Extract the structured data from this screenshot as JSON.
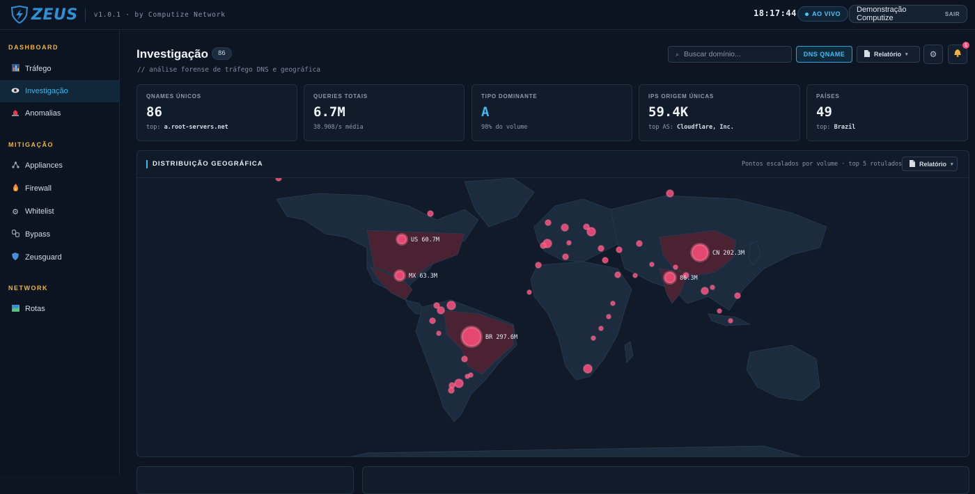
{
  "header": {
    "logo_text": "ZEUS",
    "version": "v1.0.1 · by Computize Network",
    "clock": "18:17:44",
    "live_label": "AO VIVO",
    "user_name": "Demonstração Computize",
    "logout_label": "SAIR"
  },
  "sidebar": {
    "sections": [
      {
        "title": "DASHBOARD",
        "items": [
          {
            "label": "Tráfego",
            "icon": "chart-icon"
          },
          {
            "label": "Investigação",
            "icon": "eye-icon",
            "active": true
          },
          {
            "label": "Anomalias",
            "icon": "siren-icon"
          }
        ]
      },
      {
        "title": "MITIGAÇÃO",
        "items": [
          {
            "label": "Appliances",
            "icon": "network-icon"
          },
          {
            "label": "Firewall",
            "icon": "fire-icon"
          },
          {
            "label": "Whitelist",
            "icon": "gear-icon"
          },
          {
            "label": "Bypass",
            "icon": "chain-icon"
          },
          {
            "label": "Zeusguard",
            "icon": "shield-icon"
          }
        ]
      },
      {
        "title": "NETWORK",
        "items": [
          {
            "label": "Rotas",
            "icon": "map-icon"
          }
        ]
      }
    ]
  },
  "page": {
    "title": "Investigação",
    "count": "86",
    "subtitle": "// análise forense de tráfego DNS e geográfica",
    "search_placeholder": "Buscar domínio...",
    "dns_button": "DNS QNAME",
    "report_button": "Relatório",
    "notifications_count": "1"
  },
  "stats": [
    {
      "label": "QNAMES ÚNICOS",
      "value": "86",
      "sub_prefix": "top:",
      "sub_value": "a.root-servers.net"
    },
    {
      "label": "QUERIES TOTAIS",
      "value": "6.7M",
      "sub_prefix": "38.908/s média",
      "sub_value": ""
    },
    {
      "label": "TIPO DOMINANTE",
      "value": "A",
      "sub_prefix": "98% do volume",
      "sub_value": ""
    },
    {
      "label": "IPS ORIGEM ÚNICAS",
      "value": "59.4K",
      "sub_prefix": "top AS:",
      "sub_value": "Cloudflare, Inc."
    },
    {
      "label": "PAÍSES",
      "value": "49",
      "sub_prefix": "top:",
      "sub_value": "Brazil"
    }
  ],
  "map": {
    "title": "DISTRIBUIÇÃO GEOGRÁFICA",
    "note": "Pontos escalados por volume · top 5 rotulados",
    "report_button": "Relatório",
    "labels": [
      {
        "code": "US",
        "text": "US 60.7M"
      },
      {
        "code": "MX",
        "text": "MX 63.3M"
      },
      {
        "code": "BR",
        "text": "BR 297.6M"
      },
      {
        "code": "CN",
        "text": "CN 202.3M"
      },
      {
        "code": "IN",
        "text": "86.3M"
      }
    ],
    "colors": {
      "point": "#ff4f7b",
      "land": "#1c2b3e",
      "highlight": "#5a2536"
    }
  }
}
